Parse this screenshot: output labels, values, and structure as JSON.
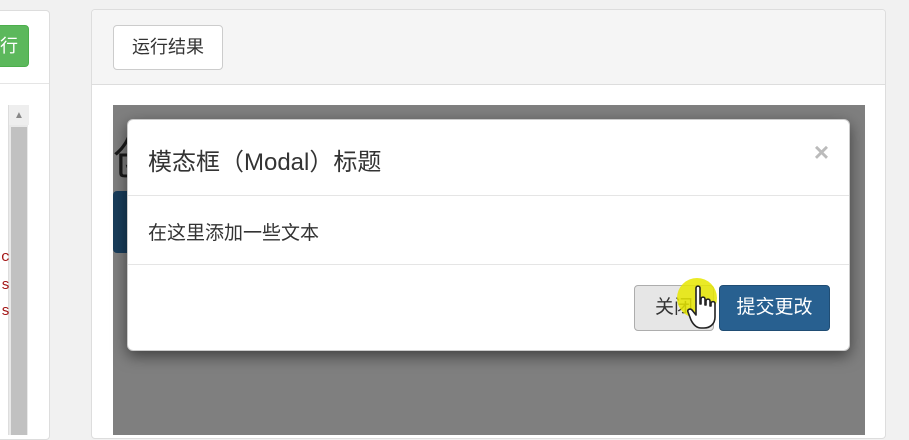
{
  "left_panel": {
    "run_button_label": "行",
    "code_fragments": [
      "c",
      "s",
      "s"
    ]
  },
  "right_panel": {
    "result_button_label": "运行结果"
  },
  "result_frame": {
    "background_heading_fragment": "创"
  },
  "modal": {
    "title": "模态框（Modal）标题",
    "close_symbol": "×",
    "body_text": "在这里添加一些文本",
    "close_button_label": "关闭",
    "submit_button_label": "提交更改"
  },
  "colors": {
    "run_button": "#5cb85c",
    "primary": "#286090",
    "code_text": "#a31515",
    "cursor_highlight": "#e6e600"
  }
}
